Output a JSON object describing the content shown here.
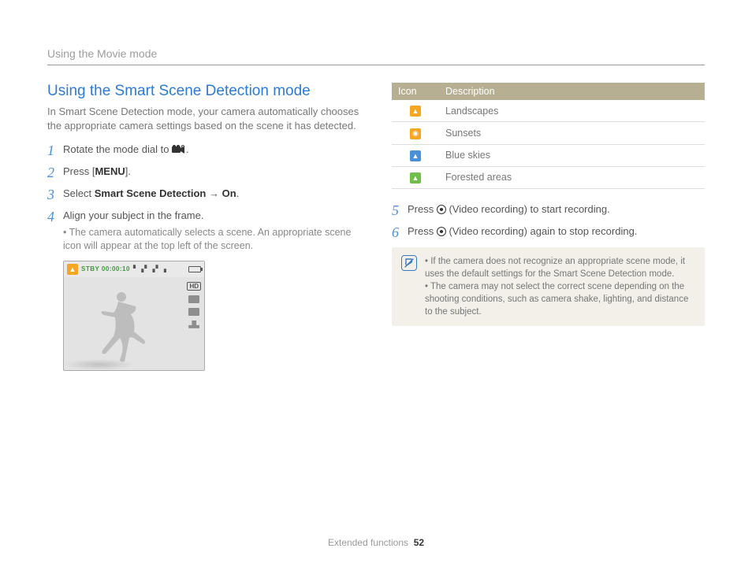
{
  "breadcrumb": "Using the Movie mode",
  "title": "Using the Smart Scene Detection mode",
  "intro": "In Smart Scene Detection mode, your camera automatically chooses the appropriate camera settings based on the scene it has detected.",
  "steps": {
    "s1": {
      "num": "1",
      "pre": "Rotate the mode dial to ",
      "post": "."
    },
    "s2": {
      "num": "2",
      "pre": "Press [",
      "label": "MENU",
      "post": "]."
    },
    "s3": {
      "num": "3",
      "pre": "Select ",
      "b1": "Smart Scene Detection",
      "arrow": " → ",
      "b2": "On",
      "post": "."
    },
    "s4": {
      "num": "4",
      "text": "Align your subject in the frame.",
      "sub": "The camera automatically selects a scene. An appropriate scene icon will appear at the top left of the screen."
    },
    "s5": {
      "num": "5",
      "pre": "Press ",
      "post": " (Video recording) to start recording."
    },
    "s6": {
      "num": "6",
      "pre": "Press ",
      "post": " (Video recording) again to stop recording."
    }
  },
  "screen": {
    "stby": "STBY 00:00:10",
    "hd": "HD"
  },
  "table": {
    "head_icon": "Icon",
    "head_desc": "Description",
    "rows": [
      {
        "icon": "orange",
        "label": "Landscapes"
      },
      {
        "icon": "orange",
        "label": "Sunsets"
      },
      {
        "icon": "blue",
        "label": "Blue skies"
      },
      {
        "icon": "green",
        "label": "Forested areas"
      }
    ]
  },
  "notes": {
    "n1": "If the camera does not recognize an appropriate scene mode, it uses the default settings for the Smart Scene Detection mode.",
    "n2": "The camera may not select the correct scene depending on the shooting conditions, such as camera shake, lighting, and distance to the subject."
  },
  "footer": {
    "section": "Extended functions",
    "page": "52"
  }
}
